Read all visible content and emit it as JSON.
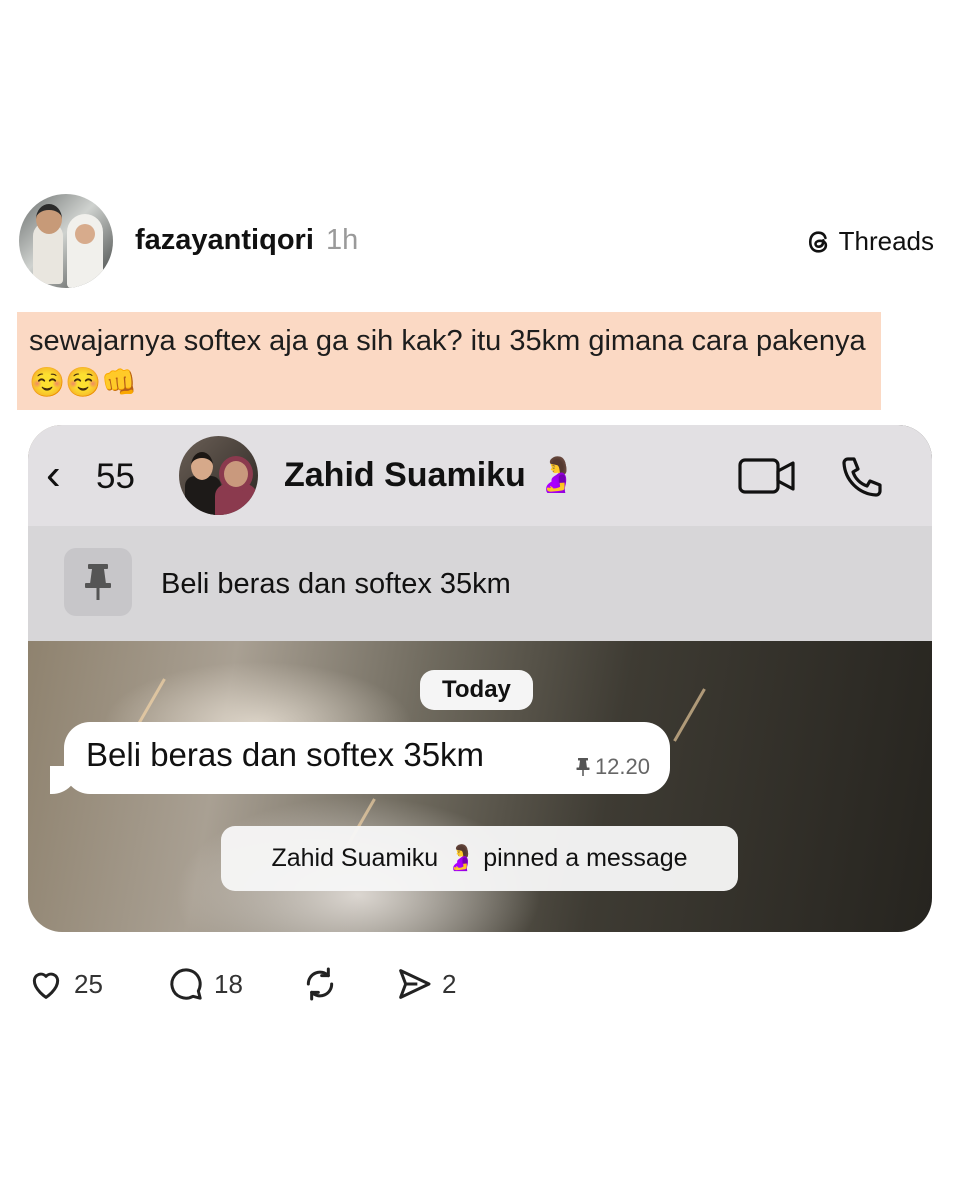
{
  "post": {
    "username": "fazayantiqori",
    "time": "1h",
    "brand": "Threads",
    "caption": "sewajarnya softex aja ga sih kak? itu 35km gimana cara pakenya☺️☺️👊"
  },
  "chat": {
    "back_count": "55",
    "contact_name": "Zahid Suamiku 🤰",
    "pinned_text": "Beli beras dan softex 35km",
    "date_label": "Today",
    "message_text": "Beli beras dan softex 35km",
    "message_time": "12.20",
    "system_message": "Zahid Suamiku 🤰 pinned a message"
  },
  "actions": {
    "likes": "25",
    "comments": "18",
    "shares": "2"
  },
  "icons": [
    "avatar",
    "threads-logo-icon",
    "back-chevron-icon",
    "video-call-icon",
    "phone-icon",
    "pin-icon",
    "heart-icon",
    "comment-icon",
    "repost-icon",
    "share-icon"
  ]
}
